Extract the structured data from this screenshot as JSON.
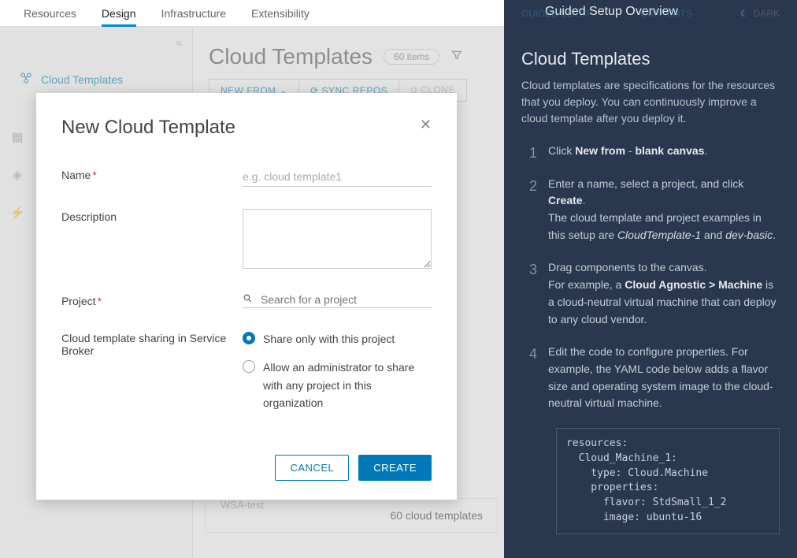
{
  "top_tabs": [
    "Resources",
    "Design",
    "Infrastructure",
    "Extensibility"
  ],
  "active_tab": "Design",
  "sidebar": {
    "item_label": "Cloud Templates"
  },
  "content": {
    "heading": "Cloud Templates",
    "count_badge": "60 items",
    "toolbar": {
      "new_from": "NEW FROM",
      "sync_repos": "SYNC REPOS",
      "clone": "CLONE"
    },
    "footer_count": "60 cloud templates",
    "ghost_text": "WSA-test"
  },
  "modal": {
    "title": "New Cloud Template",
    "labels": {
      "name": "Name",
      "description": "Description",
      "project": "Project",
      "sharing": "Cloud template sharing in Service Broker"
    },
    "placeholders": {
      "name": "e.g. cloud template1",
      "project": "Search for a project"
    },
    "radios": {
      "share_project": "Share only with this project",
      "share_admin": "Allow an administrator to share with any project in this organization"
    },
    "buttons": {
      "cancel": "CANCEL",
      "create": "CREATE"
    }
  },
  "guide": {
    "top_left": "GUIDED SETUP",
    "top_mid": "CONTENTS",
    "top_right": "DARK",
    "header": "Guided Setup Overview",
    "title": "Cloud Templates",
    "intro": "Cloud templates are specifications for the resources that you deploy. You can continuously improve a cloud template after you deploy it.",
    "steps": {
      "s1_pre": "Click ",
      "s1_b1": "New from",
      "s1_mid": " - ",
      "s1_b2": "blank canvas",
      "s1_post": ".",
      "s2_line1_a": "Enter a name, select a project, and click ",
      "s2_line1_b": "Create",
      "s2_line1_c": ".",
      "s2_line2_a": "The cloud template and project examples in this setup are ",
      "s2_line2_i1": "CloudTemplate-1",
      "s2_line2_mid": " and ",
      "s2_line2_i2": "dev-basic",
      "s2_line2_end": ".",
      "s3_a": "Drag components to the canvas.",
      "s3_b": "For example, a ",
      "s3_bold": "Cloud Agnostic > Machine",
      "s3_c": " is a cloud-neutral virtual machine that can deploy to any cloud vendor.",
      "s4_a": "Edit the code to configure properties. For example, the YAML code below adds a flavor size and operating system image to the cloud-neutral virtual machine."
    },
    "code": "resources:\n  Cloud_Machine_1:\n    type: Cloud.Machine\n    properties:\n      flavor: StdSmall_1_2\n      image: ubuntu-16"
  }
}
